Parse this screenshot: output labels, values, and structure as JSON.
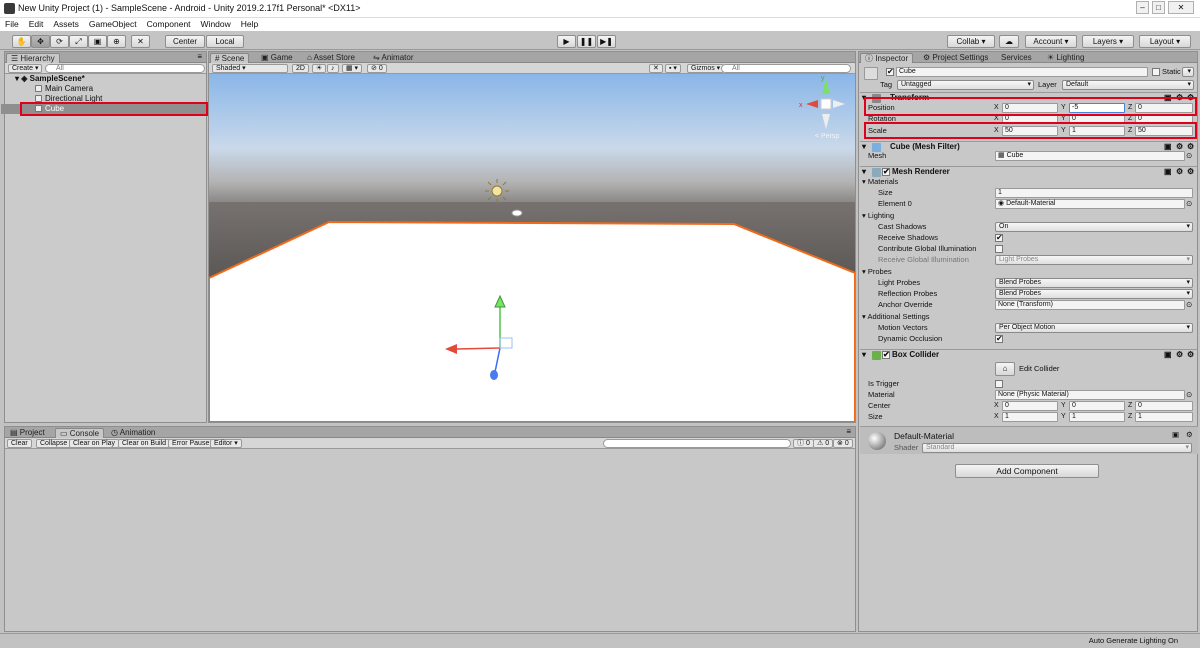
{
  "window": {
    "title": "New Unity Project (1) - SampleScene - Android - Unity 2019.2.17f1 Personal* <DX11>"
  },
  "menu": [
    "File",
    "Edit",
    "Assets",
    "GameObject",
    "Component",
    "Window",
    "Help"
  ],
  "toolbar": {
    "center": "Center",
    "local": "Local",
    "collab": "Collab",
    "account": "Account",
    "layers": "Layers",
    "layout": "Layout"
  },
  "hierarchy": {
    "tab": "Hierarchy",
    "create": "Create",
    "search_placeholder": "All",
    "scene": "SampleScene*",
    "items": [
      "Main Camera",
      "Directional Light",
      "Cube"
    ]
  },
  "scene": {
    "tabs": [
      "Scene",
      "Game",
      "Asset Store",
      "Animator"
    ],
    "shading": "Shaded",
    "mode2d": "2D",
    "fx_count": "0",
    "gizmos": "Gizmos",
    "search_placeholder": "All",
    "persp": "< Persp"
  },
  "console": {
    "tabs": [
      "Project",
      "Console",
      "Animation"
    ],
    "buttons": [
      "Clear",
      "Collapse",
      "Clear on Play",
      "Clear on Build",
      "Error Pause",
      "Editor"
    ],
    "counts": [
      "0",
      "0",
      "0"
    ]
  },
  "inspector": {
    "tabs": [
      "Inspector",
      "Project Settings",
      "Services",
      "Lighting"
    ],
    "object_name": "Cube",
    "static_label": "Static",
    "tag_label": "Tag",
    "tag_value": "Untagged",
    "layer_label": "Layer",
    "layer_value": "Default",
    "transform": {
      "title": "Transform",
      "position": {
        "label": "Position",
        "x": "0",
        "y": "-5",
        "z": "0"
      },
      "rotation": {
        "label": "Rotation",
        "x": "0",
        "y": "0",
        "z": "0"
      },
      "scale": {
        "label": "Scale",
        "x": "50",
        "y": "1",
        "z": "50"
      }
    },
    "mesh_filter": {
      "title": "Cube (Mesh Filter)",
      "mesh_label": "Mesh",
      "mesh_value": "Cube"
    },
    "mesh_renderer": {
      "title": "Mesh Renderer",
      "materials": "Materials",
      "size_label": "Size",
      "size_value": "1",
      "element0_label": "Element 0",
      "element0_value": "Default-Material",
      "lighting": "Lighting",
      "cast_shadows_label": "Cast Shadows",
      "cast_shadows_value": "On",
      "receive_shadows_label": "Receive Shadows",
      "contribute_gi_label": "Contribute Global Illumination",
      "receive_gi_label": "Receive Global Illumination",
      "receive_gi_value": "Light Probes",
      "probes": "Probes",
      "light_probes_label": "Light Probes",
      "light_probes_value": "Blend Probes",
      "reflection_probes_label": "Reflection Probes",
      "reflection_probes_value": "Blend Probes",
      "anchor_override_label": "Anchor Override",
      "anchor_override_value": "None (Transform)",
      "additional": "Additional Settings",
      "motion_vectors_label": "Motion Vectors",
      "motion_vectors_value": "Per Object Motion",
      "dynamic_occlusion_label": "Dynamic Occlusion"
    },
    "box_collider": {
      "title": "Box Collider",
      "edit_collider": "Edit Collider",
      "is_trigger_label": "Is Trigger",
      "material_label": "Material",
      "material_value": "None (Physic Material)",
      "center_label": "Center",
      "center": {
        "x": "0",
        "y": "0",
        "z": "0"
      },
      "size_label": "Size",
      "size": {
        "x": "1",
        "y": "1",
        "z": "1"
      }
    },
    "material": {
      "name": "Default-Material",
      "shader_label": "Shader",
      "shader_value": "Standard"
    },
    "add_component": "Add Component"
  },
  "status": {
    "text": "Auto Generate Lighting On"
  },
  "colors": {
    "highlight": "#e0001b",
    "sky_top": "#8ab6e8",
    "ground": "#6e6a68",
    "plane": "#ffffff",
    "plane_edge": "#f06a1a"
  }
}
